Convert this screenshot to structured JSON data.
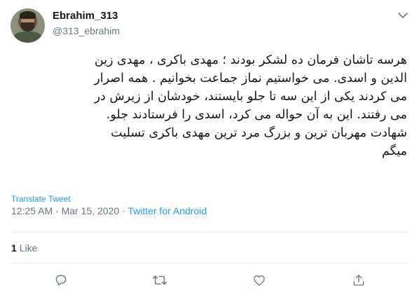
{
  "author": {
    "display_name": "Ebrahim_313",
    "handle": "@313_ebrahim"
  },
  "tweet": {
    "lines": [
      "هرسه تاشان فرمان ده لشکر بودند ؛ مهدی باکری ، مهدی زین",
      "الدین و اسدی. می خواستیم نماز جماعت بخوانیم . همه اصرار",
      "می کردند یکی از این سه تا جلو بایستند، خودشان از زیرش در",
      "می رفتند. این به آن حواله می کرد، اسدی را فرستادند جلو.",
      "شهادت مهربان ترین و بزرگ مرد ترین مهدی باکری تسلیت",
      "میگم"
    ]
  },
  "translate_label": "Translate Tweet",
  "meta": {
    "time": "12:25 AM",
    "separator": " · ",
    "date": "Mar 15, 2020",
    "source": "Twitter for Android"
  },
  "stats": {
    "likes_count": "1",
    "likes_label": "Like"
  },
  "icons": {
    "menu": "chevron-down-icon",
    "reply": "reply-icon",
    "retweet": "retweet-icon",
    "like": "heart-icon",
    "share": "share-icon"
  },
  "colors": {
    "text": "#14171a",
    "secondary": "#657786",
    "accent": "#1da1f2",
    "divider": "#e6ecf0"
  }
}
